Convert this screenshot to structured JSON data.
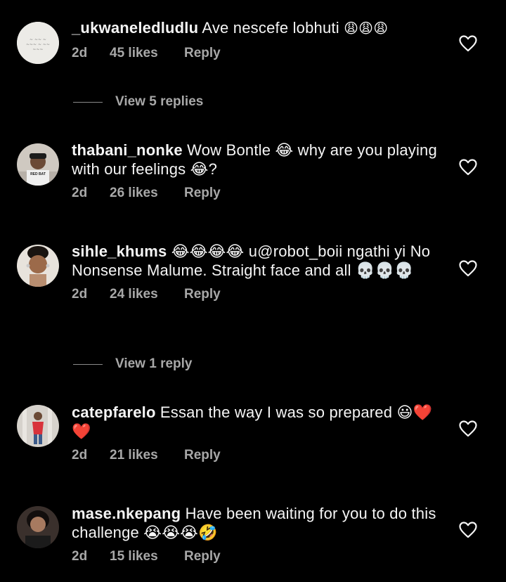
{
  "comments": [
    {
      "username": "_ukwaneledludlu",
      "text": "Ave nescefe lobhuti",
      "emojis": "😩😩😩",
      "time": "2d",
      "likes": "45 likes",
      "reply": "Reply",
      "avatar_color": "#e9e7e2"
    },
    {
      "username": "thabani_nonke",
      "text": "Wow Bontle 😂 why are you playing with our feelings 😂?",
      "time": "2d",
      "likes": "26 likes",
      "reply": "Reply",
      "avatar_color": "#d9d4cc"
    },
    {
      "username": "sihle_khums",
      "text": "😂😂😂😂 u@robot_boii ngathi yi No Nonsense Malume. Straight face and all 💀💀💀",
      "time": "2d",
      "likes": "24 likes",
      "reply": "Reply",
      "avatar_color": "#c99a7a"
    },
    {
      "username": "catepfarelo",
      "text": "Essan the way I was so prepared 😃❤️❤️",
      "time": "2d",
      "likes": "21 likes",
      "reply": "Reply",
      "avatar_color": "#c8c3bd"
    },
    {
      "username": "mase.nkepang",
      "text": "Have been waiting for you to do this challenge 😭😭😭🤣",
      "time": "2d",
      "likes": "15 likes",
      "reply": "Reply",
      "avatar_color": "#2b2220"
    }
  ],
  "view_replies": [
    {
      "label": "View 5 replies"
    },
    {
      "label": "View 1 reply"
    }
  ]
}
